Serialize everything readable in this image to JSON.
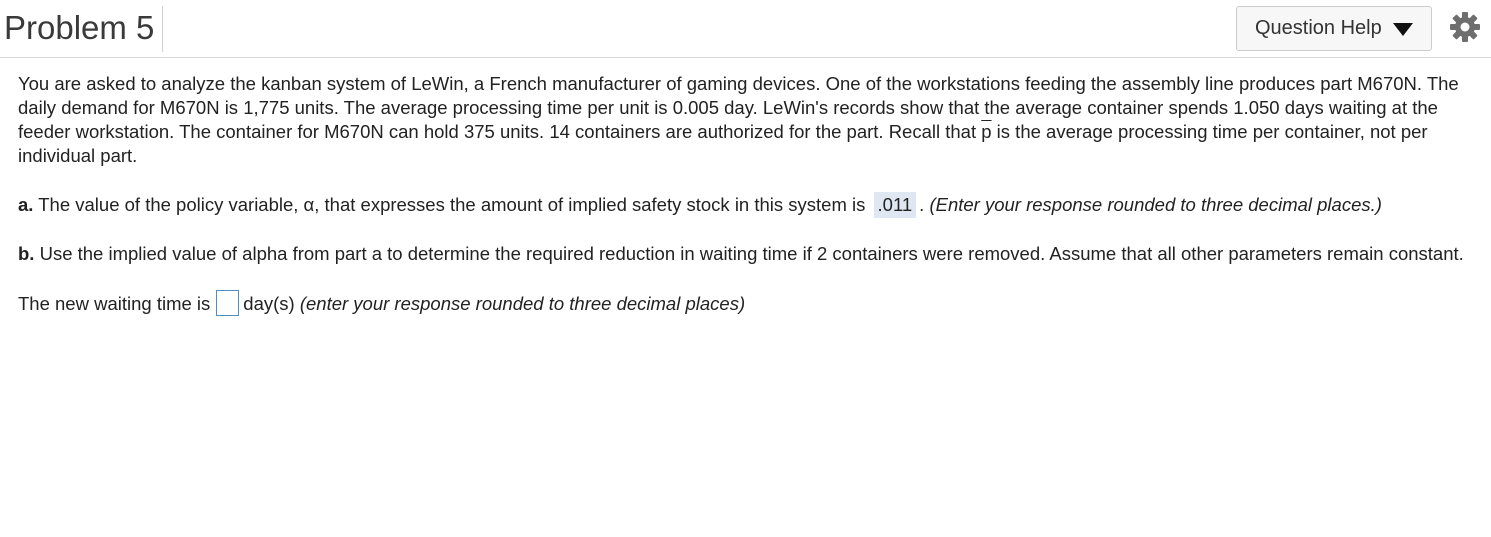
{
  "header": {
    "title": "Problem 5",
    "help_label": "Question Help"
  },
  "problem": {
    "intro_1": "You are asked to analyze the kanban system of LeWin, a French manufacturer of gaming devices. One of the workstations feeding the assembly line produces part M670N. The daily demand for M670N is 1,775 units. The average processing time per unit is 0.005 day. LeWin's records show that the average container spends 1.050 days waiting at the feeder workstation. The container for M670N can hold 375 units. 14 containers are authorized for the part. Recall that ",
    "intro_p": "p",
    "intro_2": " is the average processing time per container, not per individual part.",
    "part_a": {
      "label": "a.",
      "text": " The value of the policy variable, α, that expresses the amount of implied safety stock in this system is ",
      "answer": ".011",
      "after": ". ",
      "hint": "(Enter your response rounded to three decimal places.)"
    },
    "part_b": {
      "label": "b.",
      "text": " Use the implied value of alpha from part a to determine the required reduction in waiting time if 2 containers were removed. Assume that all other parameters remain constant."
    },
    "new_wait": {
      "prefix": "The new waiting time is",
      "value": "",
      "unit": "day(s) ",
      "hint": "(enter your response rounded to three decimal places)"
    }
  },
  "icons": {
    "caret": "caret-down-icon",
    "settings": "gear-icon"
  }
}
